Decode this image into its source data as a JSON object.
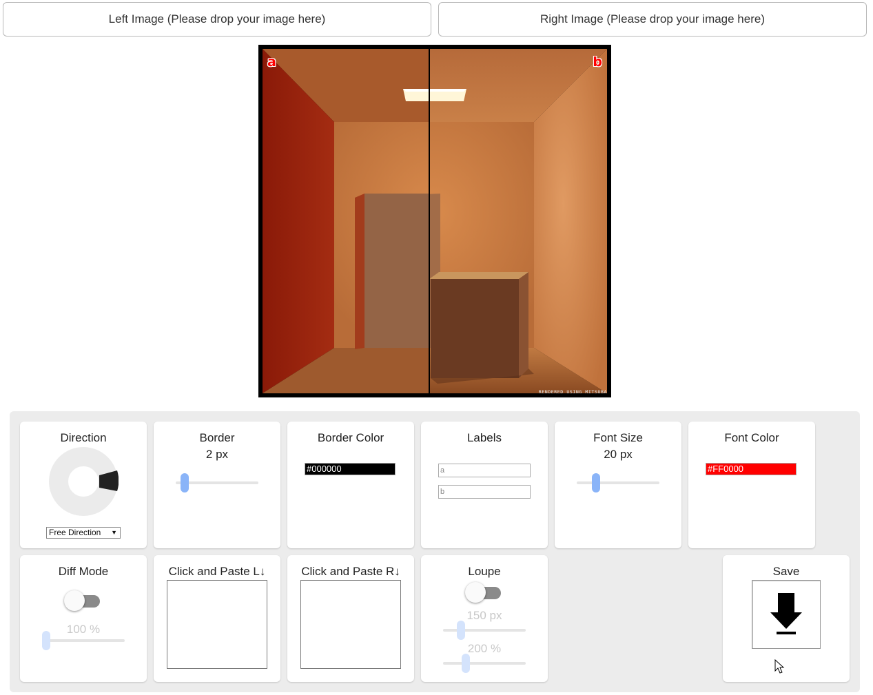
{
  "drop": {
    "left": "Left Image (Please drop your image here)",
    "right": "Right Image (Please drop your image here)"
  },
  "viewer": {
    "label_a": "a",
    "label_b": "b",
    "credit": "RENDERED USING MITSUBA",
    "divider_color": "#000000"
  },
  "controls": {
    "direction": {
      "title": "Direction",
      "select_value": "Free Direction",
      "icon": "direction-dial-icon"
    },
    "border": {
      "title": "Border",
      "value": "2 px",
      "slider_fraction": 0.05
    },
    "border_color": {
      "title": "Border Color",
      "value": "#000000",
      "swatch": "#000000"
    },
    "labels": {
      "title": "Labels",
      "left_value": "a",
      "right_value": "b"
    },
    "font_size": {
      "title": "Font Size",
      "value": "20 px",
      "slider_fraction": 0.2
    },
    "font_color": {
      "title": "Font Color",
      "value": "#FF0000",
      "swatch": "#FF0000"
    },
    "diff_mode": {
      "title": "Diff Mode",
      "enabled": false,
      "opacity_label": "100 %",
      "slider_fraction": 0.0
    },
    "paste_left": {
      "title": "Click and Paste L↓"
    },
    "paste_right": {
      "title": "Click and Paste R↓"
    },
    "loupe": {
      "title": "Loupe",
      "enabled": false,
      "size_label": "150 px",
      "zoom_label": "200 %",
      "size_fraction": 0.17,
      "zoom_fraction": 0.22
    },
    "save": {
      "title": "Save",
      "icon": "download-arrow-icon"
    }
  },
  "colors": {
    "accent": "#8ab4f8",
    "panel_bg": "#ececec",
    "label_color": "#ff0000"
  }
}
